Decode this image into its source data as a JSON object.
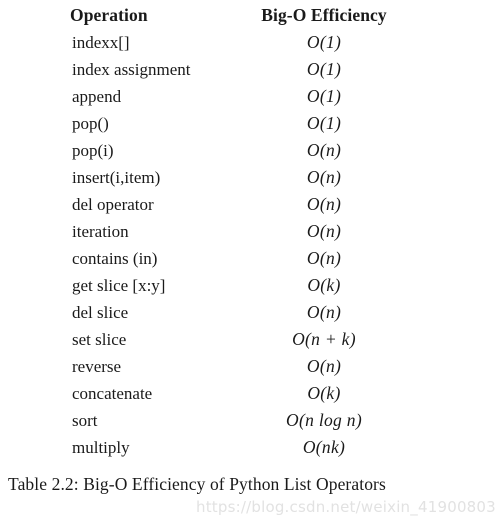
{
  "document": {
    "type": "textbook-table-figure",
    "background_color": "#ffffff",
    "text_color": "#1a1a1a"
  },
  "table": {
    "headers": {
      "operation": "Operation",
      "efficiency": "Big-O Efficiency"
    },
    "rows": [
      {
        "operation": "indexx[]",
        "efficiency": "O(1)"
      },
      {
        "operation": "index assignment",
        "efficiency": "O(1)"
      },
      {
        "operation": "append",
        "efficiency": "O(1)"
      },
      {
        "operation": "pop()",
        "efficiency": "O(1)"
      },
      {
        "operation": "pop(i)",
        "efficiency": "O(n)"
      },
      {
        "operation": "insert(i,item)",
        "efficiency": "O(n)"
      },
      {
        "operation": "del operator",
        "efficiency": "O(n)"
      },
      {
        "operation": "iteration",
        "efficiency": "O(n)"
      },
      {
        "operation": "contains (in)",
        "efficiency": "O(n)"
      },
      {
        "operation": "get slice [x:y]",
        "efficiency": "O(k)"
      },
      {
        "operation": "del slice",
        "efficiency": "O(n)"
      },
      {
        "operation": "set slice",
        "efficiency": "O(n + k)"
      },
      {
        "operation": "reverse",
        "efficiency": "O(n)"
      },
      {
        "operation": "concatenate",
        "efficiency": "O(k)"
      },
      {
        "operation": "sort",
        "efficiency": "O(n log n)"
      },
      {
        "operation": "multiply",
        "efficiency": "O(nk)"
      }
    ]
  },
  "caption": {
    "text": "Table 2.2: Big-O Efficiency of Python List Operators"
  },
  "watermark": {
    "text": "https://blog.csdn.net/weixin_41900803",
    "color": "#e2e2e2"
  }
}
